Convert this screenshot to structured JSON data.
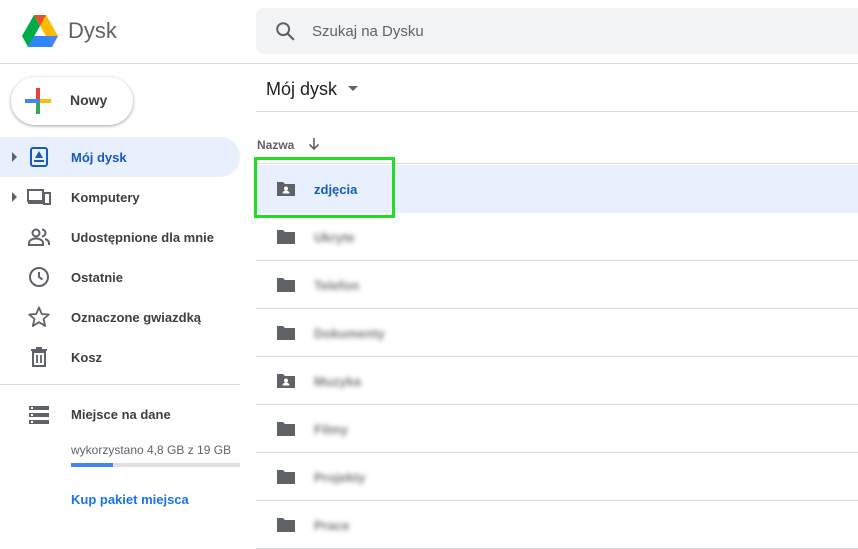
{
  "header": {
    "brand": "Dysk",
    "search_placeholder": "Szukaj na Dysku"
  },
  "sidebar": {
    "new_button": "Nowy",
    "items": [
      {
        "label": "Mój dysk",
        "icon": "my-drive-icon",
        "active": true,
        "expandable": true
      },
      {
        "label": "Komputery",
        "icon": "computers-icon",
        "active": false,
        "expandable": true
      },
      {
        "label": "Udostępnione dla mnie",
        "icon": "shared-people-icon",
        "active": false,
        "expandable": false
      },
      {
        "label": "Ostatnie",
        "icon": "clock-icon",
        "active": false,
        "expandable": false
      },
      {
        "label": "Oznaczone gwiazdką",
        "icon": "star-icon",
        "active": false,
        "expandable": false
      },
      {
        "label": "Kosz",
        "icon": "trash-icon",
        "active": false,
        "expandable": false
      }
    ],
    "storage": {
      "label": "Miejsce na dane",
      "used_text": "wykorzystano 4,8 GB z 19 GB",
      "used_fraction": 0.25,
      "buy_link": "Kup pakiet miejsca"
    }
  },
  "main": {
    "title": "Mój dysk",
    "column_name": "Nazwa",
    "rows": [
      {
        "name": "zdjęcia",
        "icon": "shared-folder-icon",
        "selected": true,
        "blurred": false
      },
      {
        "name": "Ukryte",
        "icon": "folder-icon",
        "selected": false,
        "blurred": true
      },
      {
        "name": "Telefon",
        "icon": "folder-icon",
        "selected": false,
        "blurred": true
      },
      {
        "name": "Dokumenty",
        "icon": "folder-icon",
        "selected": false,
        "blurred": true
      },
      {
        "name": "Muzyka",
        "icon": "shared-folder-icon",
        "selected": false,
        "blurred": true
      },
      {
        "name": "Filmy",
        "icon": "folder-icon",
        "selected": false,
        "blurred": true
      },
      {
        "name": "Projekty",
        "icon": "folder-icon",
        "selected": false,
        "blurred": true
      },
      {
        "name": "Prace",
        "icon": "folder-icon",
        "selected": false,
        "blurred": true
      }
    ]
  },
  "colors": {
    "accent": "#1a73e8",
    "active_bg": "#e8f0fe",
    "active_text": "#185abc",
    "highlight": "#22dd22"
  }
}
